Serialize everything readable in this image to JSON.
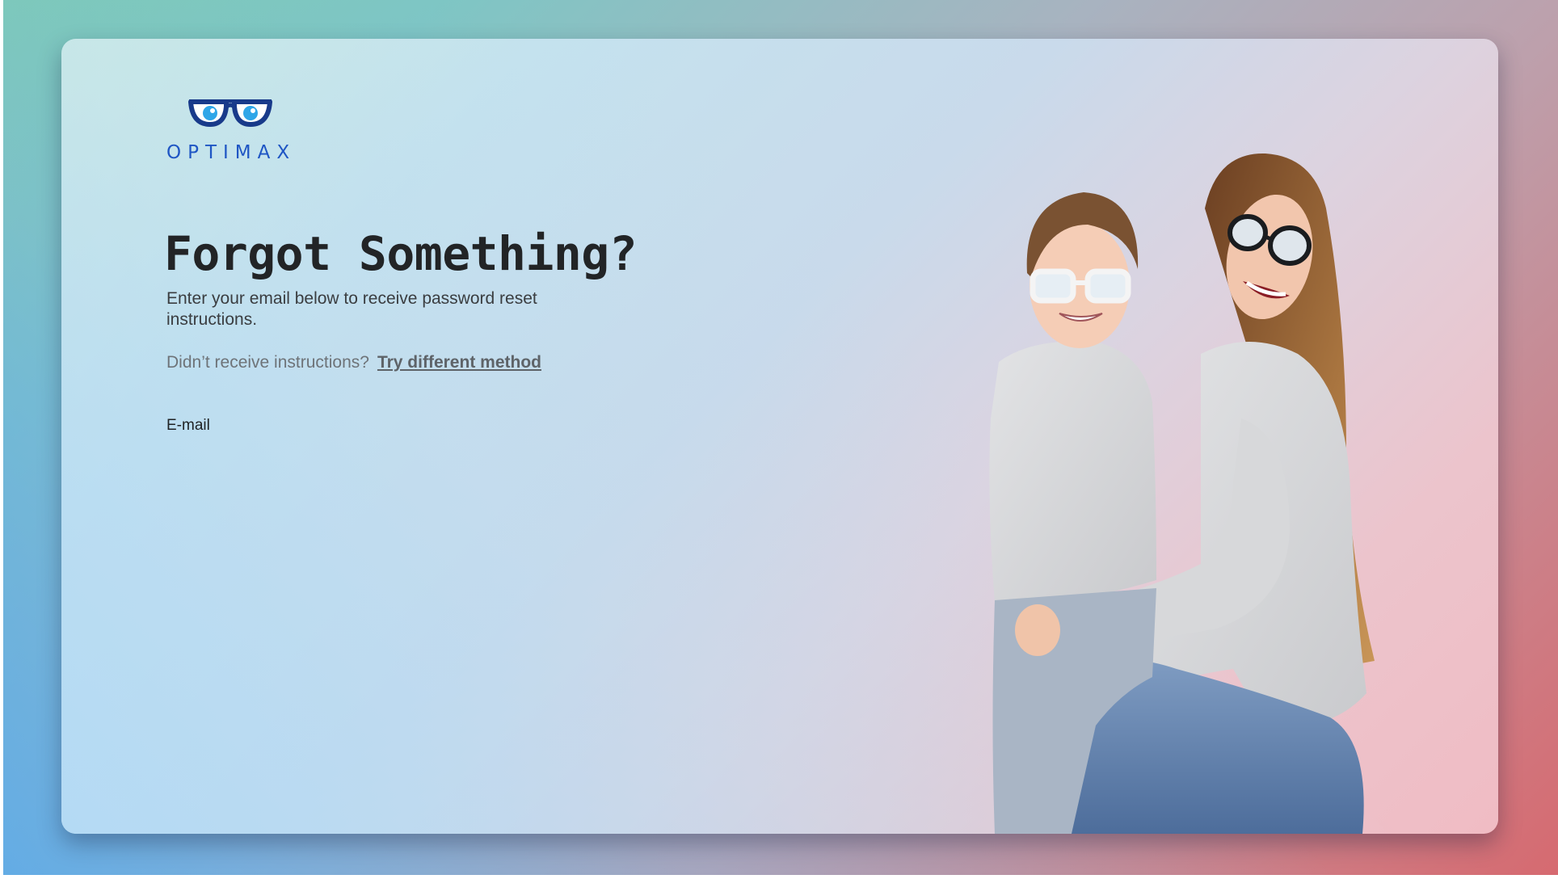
{
  "brand": {
    "name": "OPTIMAX",
    "logo_icon": "glasses-eyes-icon",
    "color": "#1f56c4"
  },
  "main": {
    "title": "Forgot Something?",
    "subtitle": "Enter your email below to receive password reset instructions.",
    "alt_prompt": "Didn’t receive instructions?",
    "alt_link": "Try different method"
  },
  "form": {
    "email_label": "E-mail",
    "email_value": "",
    "email_placeholder": ""
  },
  "hero": {
    "image": "mother-and-son-wearing-glasses-photo"
  },
  "colors": {
    "title": "#222426",
    "muted_text": "#6e7378",
    "card_left": "#c4e2ee",
    "card_right": "#f0bcc4",
    "backdrop_left": "#7fd0b0",
    "backdrop_right": "#d66a70"
  }
}
